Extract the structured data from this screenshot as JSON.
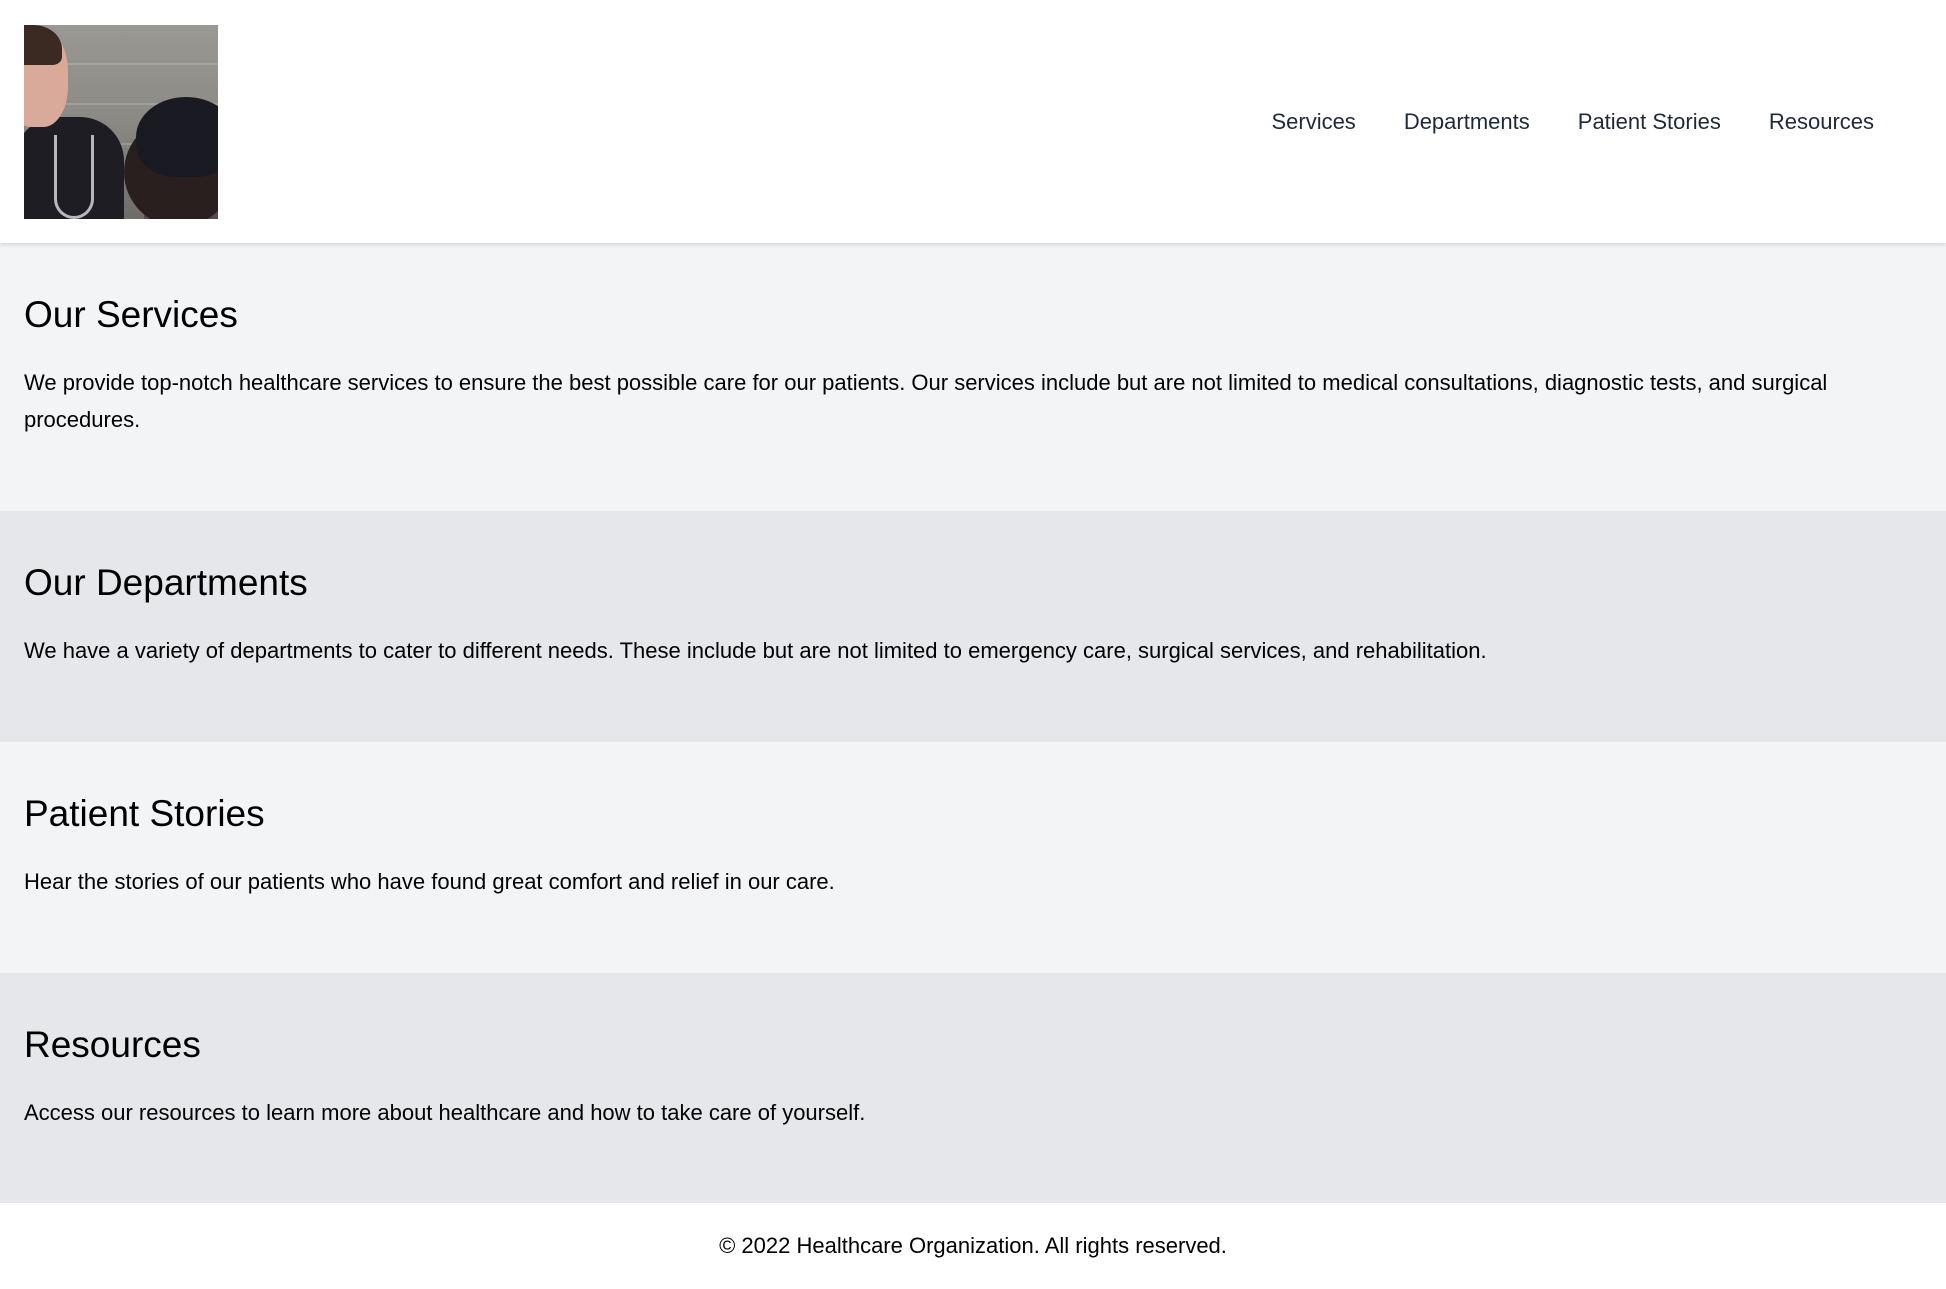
{
  "header": {
    "logo": {
      "alt": "Healthcare staff with patient photo"
    },
    "nav": [
      {
        "label": "Services"
      },
      {
        "label": "Departments"
      },
      {
        "label": "Patient Stories"
      },
      {
        "label": "Resources"
      }
    ]
  },
  "sections": [
    {
      "id": "services",
      "title": "Our Services",
      "body": "We provide top-notch healthcare services to ensure the best possible care for our patients. Our services include but are not limited to medical consultations, diagnostic tests, and surgical procedures."
    },
    {
      "id": "departments",
      "title": "Our Departments",
      "body": "We have a variety of departments to cater to different needs. These include but are not limited to emergency care, surgical services, and rehabilitation."
    },
    {
      "id": "patient-stories",
      "title": "Patient Stories",
      "body": "Hear the stories of our patients who have found great comfort and relief in our care."
    },
    {
      "id": "resources",
      "title": "Resources",
      "body": "Access our resources to learn more about healthcare and how to take care of yourself."
    }
  ],
  "footer": {
    "copyright": "© 2022 Healthcare Organization. All rights reserved."
  },
  "colors": {
    "section_light": "#f3f4f6",
    "section_dark": "#e5e7eb",
    "nav_text": "#1f2937",
    "body_text": "#000000"
  }
}
